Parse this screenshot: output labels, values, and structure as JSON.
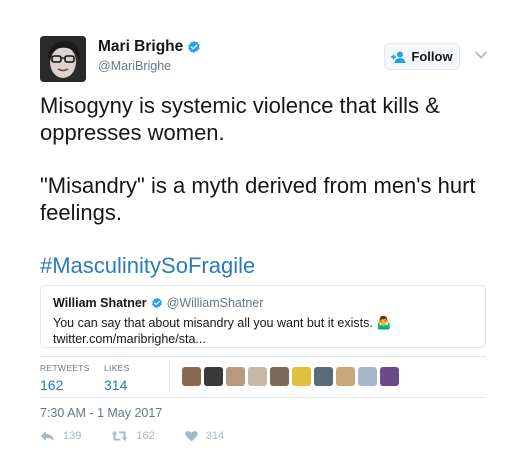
{
  "user": {
    "display_name": "Mari Brighe",
    "handle": "@MariBrighe",
    "verified": true
  },
  "follow_label": "Follow",
  "tweet": {
    "paragraph1": "Misogyny is systemic violence that kills & oppresses women.",
    "paragraph2": "\"Misandry\" is a myth derived from men's hurt feelings.",
    "hashtag": "#MasculinitySoFragile"
  },
  "quoted": {
    "name": "William Shatner",
    "handle": "@WilliamShatner",
    "text": "You can say that about misandry all you want but it exists. 🤷‍♂️ twitter.com/maribrighe/sta..."
  },
  "stats": {
    "retweets_label": "RETWEETS",
    "retweets": "162",
    "likes_label": "LIKES",
    "likes": "314"
  },
  "likers": [
    "#8a6a52",
    "#3a3a3a",
    "#b89a82",
    "#c9b8a8",
    "#7a6a58",
    "#e2c03a",
    "#5a6a78",
    "#c8a878",
    "#a8b8c8",
    "#6a4a8a"
  ],
  "timestamp": "7:30 AM - 1 May 2017",
  "actions": {
    "replies": "139",
    "retweets": "162",
    "likes": "314"
  },
  "colors": {
    "link": "#2b7bb9",
    "muted": "#657786",
    "verified": "#1da1f2"
  }
}
